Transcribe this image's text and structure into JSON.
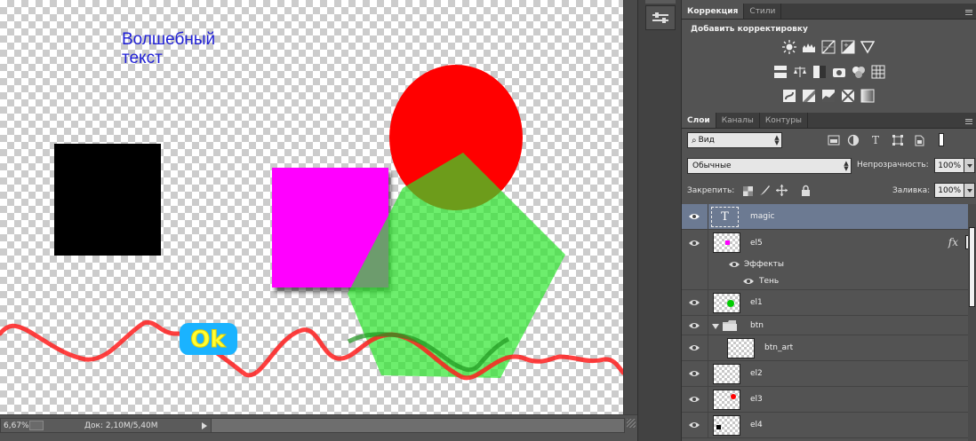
{
  "canvas": {
    "text": "Волшебный\nтекст",
    "button_label": "Ok",
    "colors": {
      "red_circle": "#ff0000",
      "magenta": "#ff00ff",
      "green_poly": "#5cf25c",
      "curve": "#ff2020",
      "button": "#1ab3ff"
    }
  },
  "status": {
    "zoom": "6,67%",
    "doc": "Док: 2,10M/5,40M"
  },
  "adjustments": {
    "tabs": [
      "Коррекция",
      "Стили"
    ],
    "title": "Добавить корректировку"
  },
  "layers_panel": {
    "tabs": [
      "Слои",
      "Каналы",
      "Контуры"
    ],
    "filter_kind": "Вид",
    "blend_mode": "Обычные",
    "opacity_label": "Непрозрачность:",
    "opacity_value": "100%",
    "lock_label": "Закрепить:",
    "fill_label": "Заливка:",
    "fill_value": "100%",
    "layers": [
      {
        "name": "magic",
        "kind": "text",
        "selected": true
      },
      {
        "name": "el5",
        "kind": "pixel",
        "fx": "fx",
        "dot": "#ff00ff"
      },
      {
        "name": "Эффекты",
        "kind": "effects"
      },
      {
        "name": "Тень",
        "kind": "effect"
      },
      {
        "name": "el1",
        "kind": "pixel",
        "dot": "#00cc00"
      },
      {
        "name": "btn",
        "kind": "group"
      },
      {
        "name": "btn_art",
        "kind": "pixel"
      },
      {
        "name": "el2",
        "kind": "pixel"
      },
      {
        "name": "el3",
        "kind": "pixel",
        "dot": "#ff0000"
      },
      {
        "name": "el4",
        "kind": "pixel",
        "dot": "#000000"
      }
    ]
  }
}
